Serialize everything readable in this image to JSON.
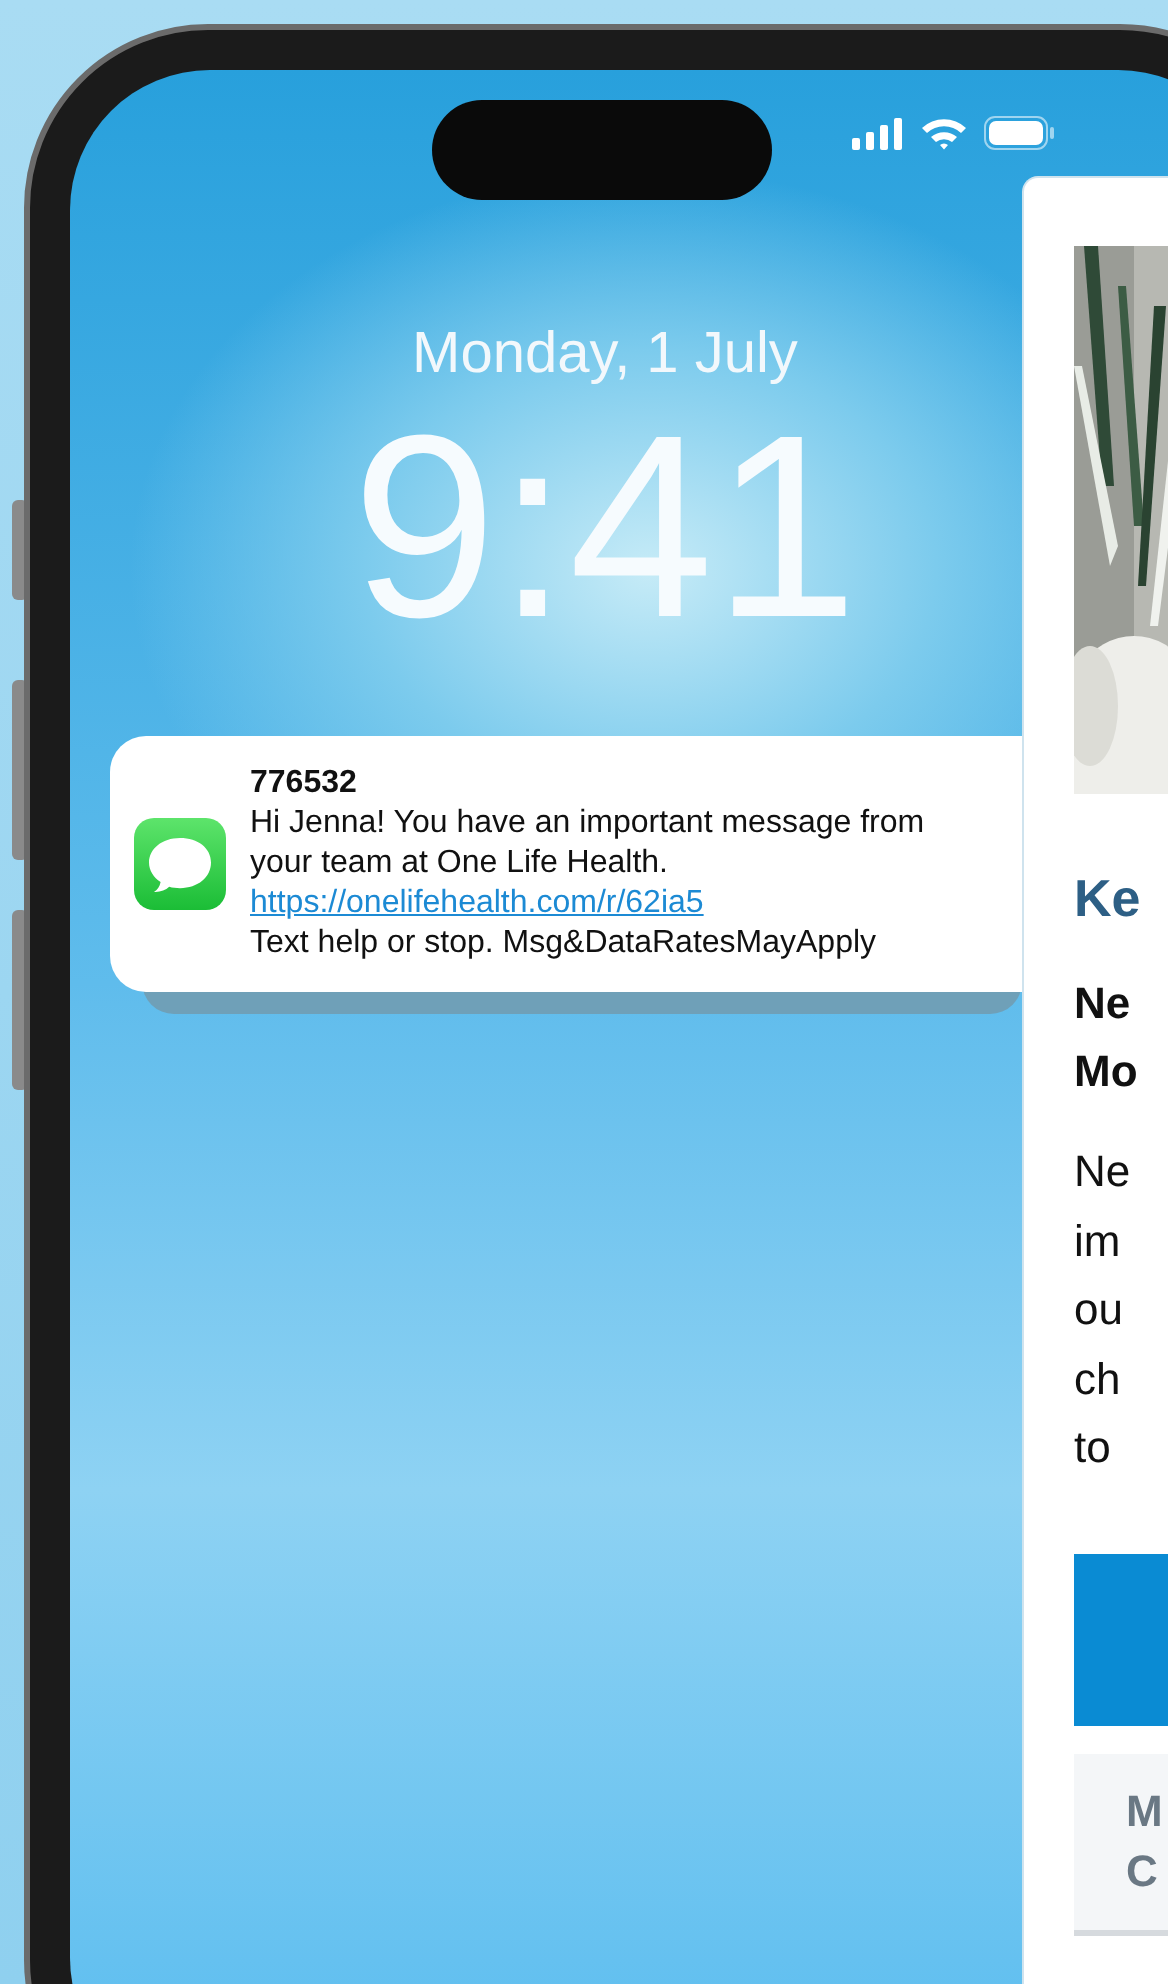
{
  "lock_screen": {
    "date": "Monday, 1 July",
    "time": "9:41"
  },
  "notification": {
    "sender": "776532",
    "message_lines": [
      "Hi Jenna! You have an important message from",
      "your team at One Life Health."
    ],
    "link": "https://onelifehealth.com/r/62ia5",
    "footer": "Text help or stop. Msg&DataRatesMayApply"
  },
  "web_panel": {
    "title": "Ke",
    "heading_lines": [
      "Ne",
      "Mo"
    ],
    "body_lines": [
      "Ne",
      "im",
      "ou",
      "ch",
      "to"
    ],
    "tab_lines": [
      "M",
      "C"
    ]
  }
}
